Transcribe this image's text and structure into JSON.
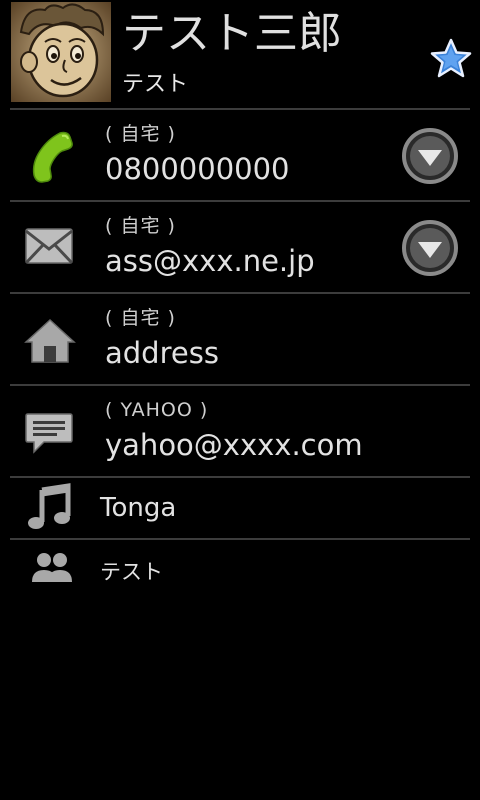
{
  "contact": {
    "name": "テスト三郎",
    "subtitle": "テスト",
    "avatar_icon": "cartoon-face-portrait",
    "favorite_icon": "star-icon"
  },
  "details": [
    {
      "type": "phone",
      "icon": "phone-icon",
      "label": "( 自宅 )",
      "value": "0800000000",
      "action_icon": "dropdown-icon"
    },
    {
      "type": "email",
      "icon": "email-icon",
      "label": "( 自宅 )",
      "value": "ass@xxx.ne.jp",
      "action_icon": "dropdown-icon"
    },
    {
      "type": "address",
      "icon": "home-icon",
      "label": "( 自宅 )",
      "value": "address"
    },
    {
      "type": "im",
      "icon": "chat-icon",
      "label": "( YAHOO )",
      "value": "yahoo@xxxx.com"
    }
  ],
  "ringtone": {
    "icon": "music-note-icon",
    "value": "Tonga"
  },
  "group": {
    "icon": "group-icon",
    "value": "テスト"
  },
  "colors": {
    "background": "#000000",
    "divider": "#3c3c3c",
    "phone_green": "#7fc41c",
    "star_blue": "#3b82d8"
  }
}
